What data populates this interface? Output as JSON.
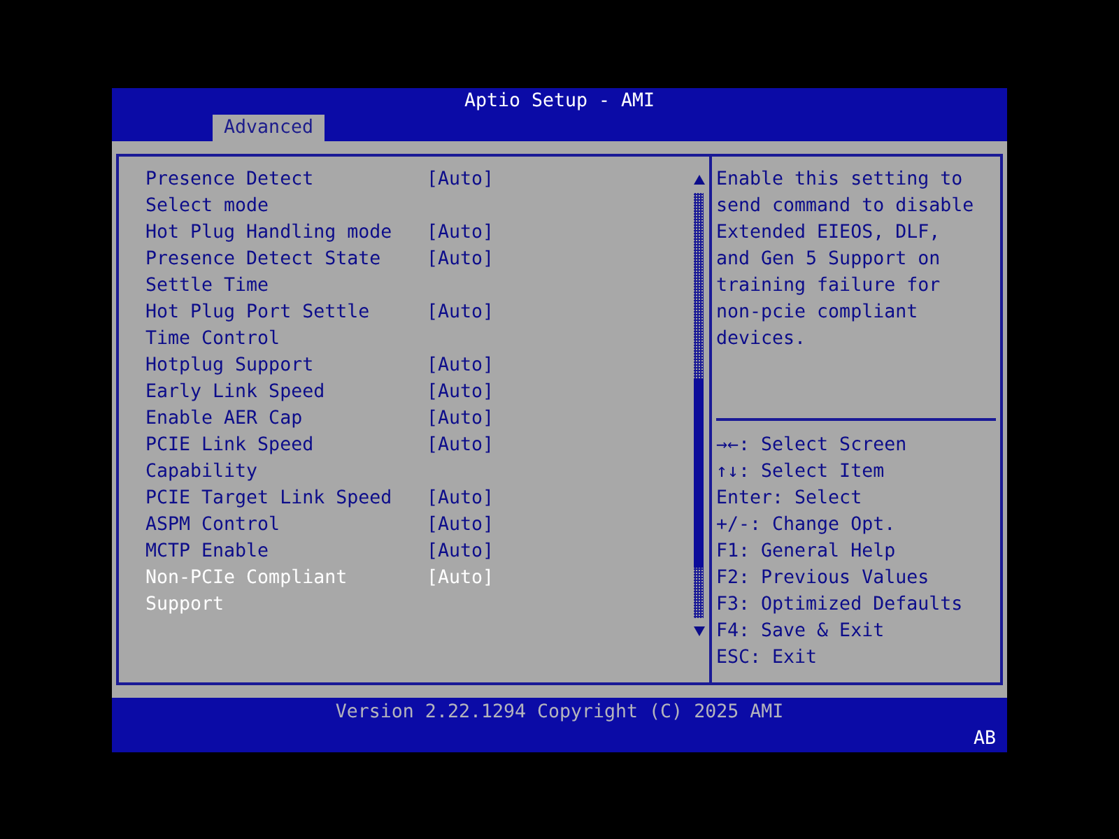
{
  "window": {
    "title": "Aptio Setup - AMI"
  },
  "tabs": [
    {
      "label": "Advanced",
      "selected": true
    }
  ],
  "settings": [
    {
      "lines": [
        "Presence Detect",
        "Select mode"
      ],
      "value": "[Auto]",
      "selected": false
    },
    {
      "lines": [
        "Hot Plug Handling mode"
      ],
      "value": "[Auto]",
      "selected": false
    },
    {
      "lines": [
        "Presence Detect State",
        "Settle Time"
      ],
      "value": "[Auto]",
      "selected": false
    },
    {
      "lines": [
        "Hot Plug Port Settle",
        "Time Control"
      ],
      "value": "[Auto]",
      "selected": false
    },
    {
      "lines": [
        "Hotplug Support"
      ],
      "value": "[Auto]",
      "selected": false
    },
    {
      "lines": [
        "Early Link Speed"
      ],
      "value": "[Auto]",
      "selected": false
    },
    {
      "lines": [
        "Enable AER Cap"
      ],
      "value": "[Auto]",
      "selected": false
    },
    {
      "lines": [
        "PCIE Link Speed",
        "Capability"
      ],
      "value": "[Auto]",
      "selected": false
    },
    {
      "lines": [
        "PCIE Target Link Speed"
      ],
      "value": "[Auto]",
      "selected": false
    },
    {
      "lines": [
        "ASPM Control"
      ],
      "value": "[Auto]",
      "selected": false
    },
    {
      "lines": [
        "MCTP Enable"
      ],
      "value": "[Auto]",
      "selected": false
    },
    {
      "lines": [
        "Non-PCIe Compliant",
        "Support"
      ],
      "value": "[Auto]",
      "selected": true
    }
  ],
  "help_text": "Enable this setting to send command to disable Extended EIEOS, DLF, and Gen 5 Support on training failure for non-pcie compliant devices.",
  "key_help": [
    "→←: Select Screen",
    "↑↓: Select Item",
    "Enter: Select",
    "+/-: Change Opt.",
    "F1: General Help",
    "F2: Previous Values",
    "F3: Optimized Defaults",
    "F4: Save & Exit",
    "ESC: Exit"
  ],
  "status_bar": {
    "version": "Version 2.22.1294 Copyright (C) 2025 AMI",
    "corner_text": "AB"
  }
}
